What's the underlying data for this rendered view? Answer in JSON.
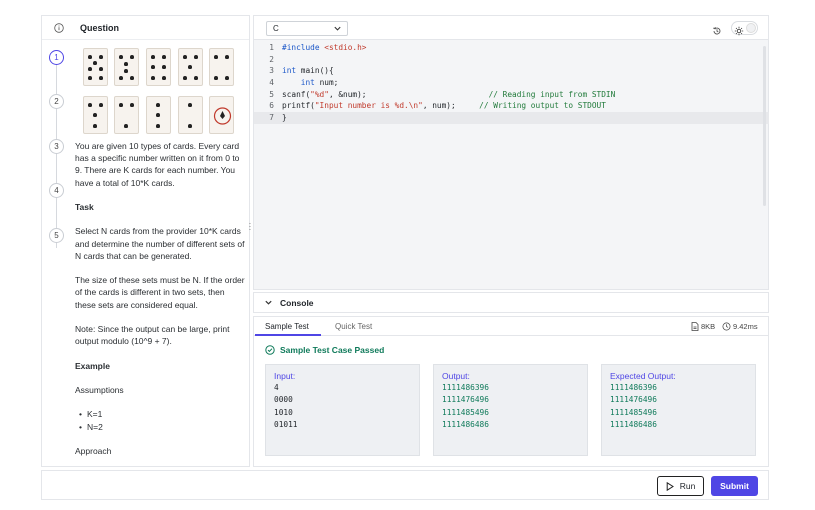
{
  "question": {
    "title": "Question",
    "steps": [
      "1",
      "2",
      "3",
      "4",
      "5"
    ],
    "paragraphs": {
      "intro": "You are given 10 types of cards. Every card has a specific number written on it from 0 to 9. There are K cards for each number. You have a total of 10*K cards.",
      "task_heading": "Task",
      "task": "Select N cards from the provider 10*K cards and determine the number of different sets of N cards that can be generated.",
      "size": "The size of these sets must be N. If the order of the cards is different in two sets, then these sets are considered equal.",
      "note": "Note: Since the output can be large, print output modulo (10^9 + 7).",
      "example_heading": "Example",
      "assumptions": "Assumptions",
      "bullets": [
        "K=1",
        "N=2"
      ],
      "approach": "Approach"
    }
  },
  "editor": {
    "language": "C",
    "lines": [
      {
        "n": "1",
        "parts": [
          [
            "kw",
            "#include "
          ],
          [
            "str",
            "<stdio.h>"
          ]
        ]
      },
      {
        "n": "2",
        "parts": [
          [
            "",
            ""
          ]
        ]
      },
      {
        "n": "3",
        "parts": [
          [
            "kw",
            "int"
          ],
          [
            "",
            " main(){"
          ]
        ]
      },
      {
        "n": "4",
        "parts": [
          [
            "",
            "    "
          ],
          [
            "kw",
            "int"
          ],
          [
            "",
            " num;"
          ]
        ]
      },
      {
        "n": "5",
        "parts": [
          [
            "",
            "scanf("
          ],
          [
            "str",
            "\"%d\""
          ],
          [
            "",
            ", &num);                          "
          ],
          [
            "cm",
            "// Reading input from STDIN"
          ]
        ]
      },
      {
        "n": "6",
        "parts": [
          [
            "",
            "printf("
          ],
          [
            "str",
            "\"Input number is %d.\\n\""
          ],
          [
            "",
            ", num);     "
          ],
          [
            "cm",
            "// Writing output to STDOUT"
          ]
        ]
      },
      {
        "n": "7",
        "parts": [
          [
            "",
            "}"
          ]
        ]
      }
    ],
    "current_line": 7
  },
  "console": {
    "label": "Console",
    "tabs": {
      "active": "Sample Test",
      "inactive": "Quick Test"
    },
    "memory": "8KB",
    "time": "9.42ms",
    "status": "Sample Test Case Passed",
    "input": {
      "title": "Input:",
      "lines": [
        "4",
        "0000",
        "1010",
        "01011"
      ]
    },
    "output": {
      "title": "Output:",
      "lines": [
        "1111486396",
        "1111476496",
        "1111485496",
        "1111486486"
      ]
    },
    "expected": {
      "title": "Expected Output:",
      "lines": [
        "1111486396",
        "1111476496",
        "1111485496",
        "1111486486"
      ]
    }
  },
  "footer": {
    "run_label": "Run",
    "submit_label": "Submit"
  },
  "colors": {
    "accent": "#4f46e5",
    "success": "#0f7a5a"
  }
}
